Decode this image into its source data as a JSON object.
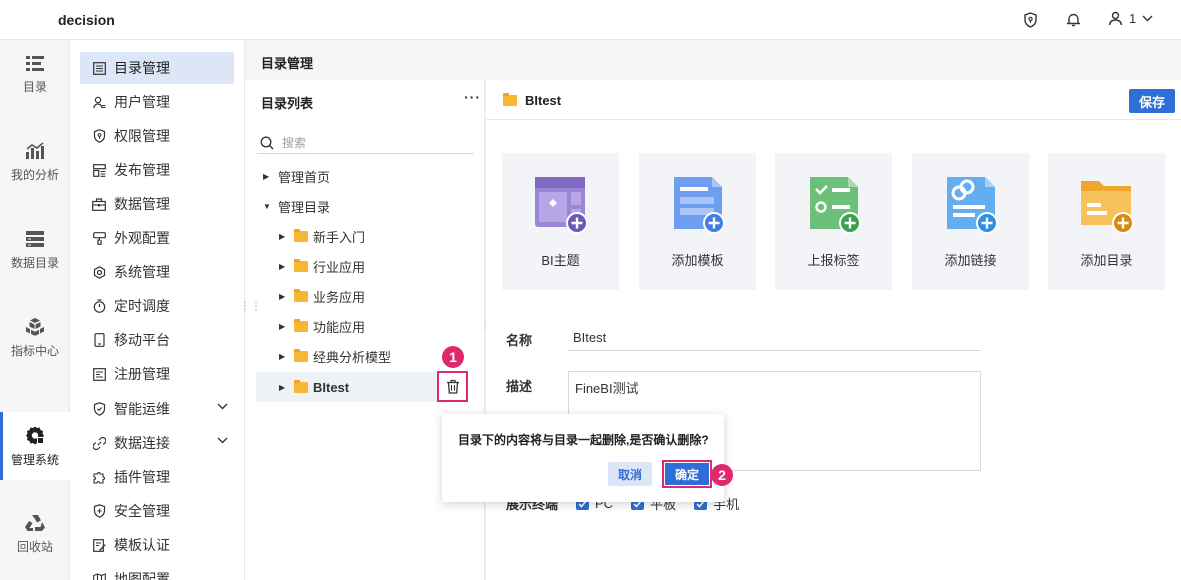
{
  "app": {
    "title": "decision"
  },
  "topbar": {
    "user_label": "1"
  },
  "rail": [
    {
      "label": "目录",
      "icon": "catalog-icon"
    },
    {
      "label": "我的分析",
      "icon": "analysis-icon"
    },
    {
      "label": "数据目录",
      "icon": "data-catalog-icon"
    },
    {
      "label": "指标中心",
      "icon": "metrics-icon"
    },
    {
      "label": "管理系统",
      "icon": "gear-icon",
      "active": true
    },
    {
      "label": "回收站",
      "icon": "recycle-icon"
    }
  ],
  "menu": [
    {
      "label": "目录管理",
      "active": true
    },
    {
      "label": "用户管理"
    },
    {
      "label": "权限管理"
    },
    {
      "label": "发布管理"
    },
    {
      "label": "数据管理"
    },
    {
      "label": "外观配置"
    },
    {
      "label": "系统管理"
    },
    {
      "label": "定时调度"
    },
    {
      "label": "移动平台"
    },
    {
      "label": "注册管理"
    },
    {
      "label": "智能运维",
      "expandable": true
    },
    {
      "label": "数据连接",
      "expandable": true
    },
    {
      "label": "插件管理"
    },
    {
      "label": "安全管理"
    },
    {
      "label": "模板认证"
    },
    {
      "label": "地图配置"
    }
  ],
  "content": {
    "title": "目录管理"
  },
  "tree": {
    "title": "目录列表",
    "more": "···",
    "search_placeholder": "搜索",
    "nodes": [
      {
        "label": "管理首页"
      },
      {
        "label": "管理目录"
      },
      {
        "label": "新手入门"
      },
      {
        "label": "行业应用"
      },
      {
        "label": "业务应用"
      },
      {
        "label": "功能应用"
      },
      {
        "label": "经典分析模型"
      },
      {
        "label": "BItest"
      }
    ]
  },
  "detail": {
    "title": "BItest",
    "save_label": "保存",
    "cards": [
      {
        "label": "BI主题",
        "icon": "bi-theme-icon"
      },
      {
        "label": "添加模板",
        "icon": "add-template-icon"
      },
      {
        "label": "上报标签",
        "icon": "report-tag-icon"
      },
      {
        "label": "添加链接",
        "icon": "add-link-icon"
      },
      {
        "label": "添加目录",
        "icon": "add-folder-icon"
      }
    ],
    "name_label": "名称",
    "name_value": "BItest",
    "desc_label": "描述",
    "desc_value": "FineBI测试",
    "terminal_label": "展示终端",
    "terminals": [
      "PC",
      "平板",
      "手机"
    ]
  },
  "popover": {
    "message": "目录下的内容将与目录一起删除,是否确认删除?",
    "cancel_label": "取消",
    "confirm_label": "确定"
  },
  "annotations": {
    "step1": "1",
    "step2": "2"
  },
  "colors": {
    "accent": "#2f6ed6",
    "highlight": "#e0286e",
    "folder": "#f7b733"
  }
}
